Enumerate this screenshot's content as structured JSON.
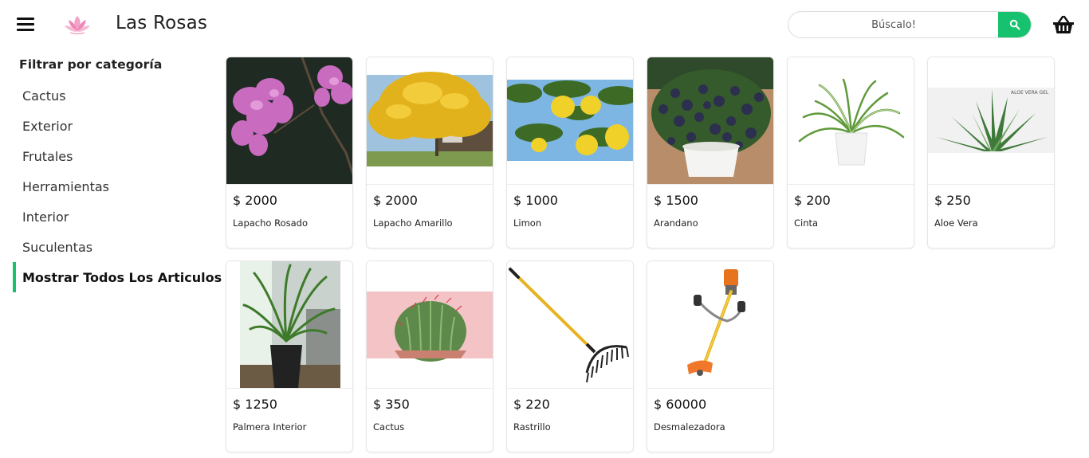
{
  "header": {
    "brand": "Las Rosas",
    "search_placeholder": "Búscalo!"
  },
  "sidebar": {
    "title": "Filtrar por categoría",
    "categories": [
      {
        "label": "Cactus"
      },
      {
        "label": "Exterior"
      },
      {
        "label": "Frutales"
      },
      {
        "label": "Herramientas"
      },
      {
        "label": "Interior"
      },
      {
        "label": "Suculentas"
      },
      {
        "label": "Mostrar Todos Los Articulos",
        "active": true
      }
    ]
  },
  "products": [
    {
      "price": "$ 2000",
      "name": "Lapacho Rosado"
    },
    {
      "price": "$ 2000",
      "name": "Lapacho Amarillo"
    },
    {
      "price": "$ 1000",
      "name": "Limon"
    },
    {
      "price": "$ 1500",
      "name": "Arandano"
    },
    {
      "price": "$ 200",
      "name": "Cinta"
    },
    {
      "price": "$ 250",
      "name": "Aloe Vera",
      "image_text": "ALOE VERA GEL"
    },
    {
      "price": "$ 1250",
      "name": "Palmera Interior"
    },
    {
      "price": "$ 350",
      "name": "Cactus"
    },
    {
      "price": "$ 220",
      "name": "Rastrillo"
    },
    {
      "price": "$ 60000",
      "name": "Desmalezadora"
    }
  ],
  "colors": {
    "accent": "#17c26e",
    "card_border": "#e6e6e6"
  },
  "icons": [
    "hamburger-menu-icon",
    "lotus-logo-icon",
    "search-icon",
    "basket-icon"
  ]
}
